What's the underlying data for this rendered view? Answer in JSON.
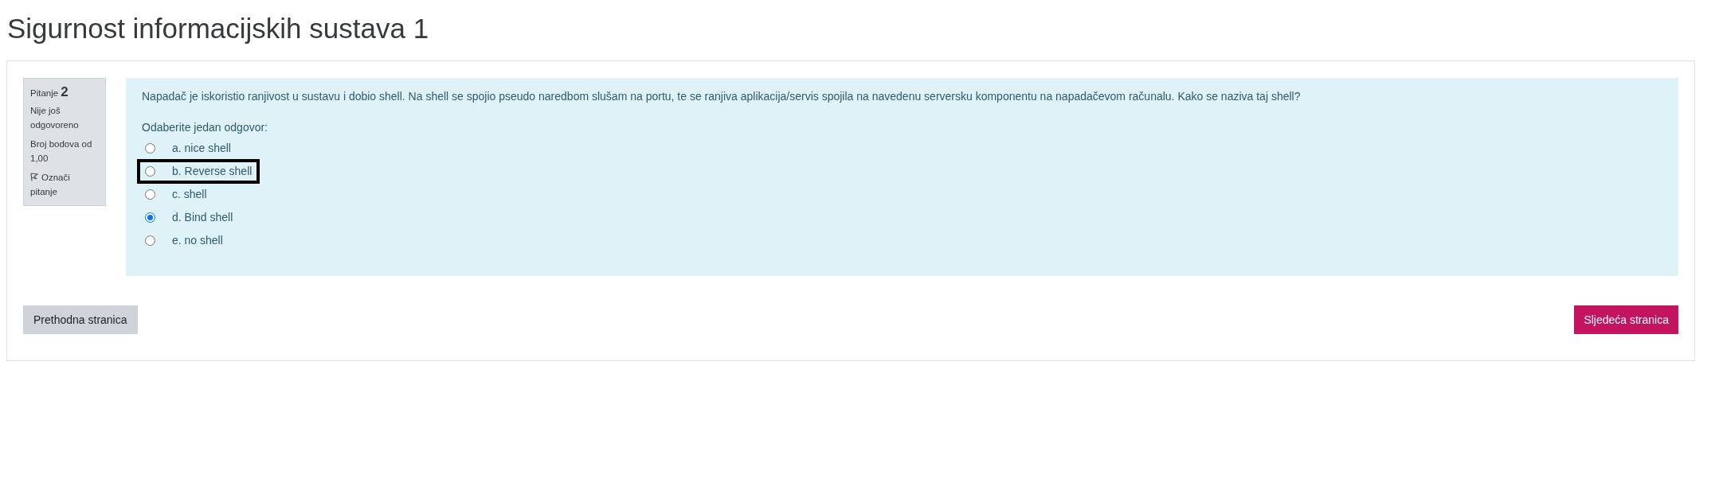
{
  "page_title": "Sigurnost informacijskih sustava 1",
  "question_info": {
    "label": "Pitanje",
    "number": "2",
    "status": "Nije još odgovoreno",
    "points": "Broj bodova od 1,00",
    "flag": "Označi pitanje"
  },
  "question": {
    "text": "Napadač je iskoristio ranjivost u sustavu i dobio shell. Na shell se spojio pseudo naredbom slušam na portu, te se ranjiva aplikacija/servis spojila na navedenu serversku komponentu na napadačevom računalu. Kako se naziva taj shell?",
    "prompt": "Odaberite jedan odgovor:",
    "options": [
      {
        "label": "a. nice shell",
        "selected": false,
        "highlighted": false
      },
      {
        "label": "b. Reverse shell",
        "selected": false,
        "highlighted": true
      },
      {
        "label": "c. shell",
        "selected": false,
        "highlighted": false
      },
      {
        "label": "d. Bind shell",
        "selected": true,
        "highlighted": false
      },
      {
        "label": "e. no shell",
        "selected": false,
        "highlighted": false
      }
    ]
  },
  "buttons": {
    "previous": "Prethodna stranica",
    "next": "Sljedeća stranica"
  }
}
